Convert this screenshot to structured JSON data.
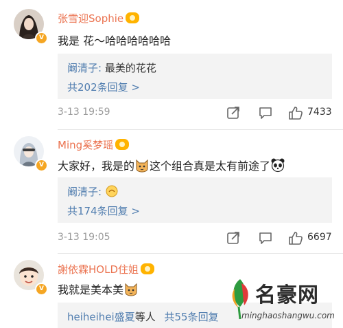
{
  "comments": [
    {
      "username": "张雪迎Sophie",
      "text": "我是 花～哈哈哈哈哈哈",
      "reply_preview_author": "阚清子:",
      "reply_preview_text": "最美的花花",
      "reply_count": "共202条回复 >",
      "time": "3-13 19:59",
      "likes": "7433"
    },
    {
      "username": "Ming奚梦瑶",
      "text_parts": [
        "大家好，我是的",
        "这个组合真是太有前途了"
      ],
      "reply_preview_author": "阚清子:",
      "reply_count": "共174条回复 >",
      "time": "3-13 19:05",
      "likes": "6697"
    },
    {
      "username": "謝依霖HOLD住姐",
      "text": "我就是美本美",
      "reply_preview_author": "heiheihei盛夏",
      "reply_preview_text": "等人",
      "reply_count": "共55条回复"
    }
  ],
  "watermark": {
    "brand": "名豪网",
    "url": "minghaoshangwu.com"
  },
  "icons": {
    "share": "share-icon",
    "comment": "comment-icon",
    "like": "thumbs-up-icon",
    "verified": "verified-badge-icon",
    "medal": "fan-medal-icon"
  },
  "colors": {
    "username": "#eb7350",
    "link": "#507daf",
    "reply_bg": "#f3f3f3",
    "meta": "#9b9b9b",
    "verified": "#f5a623"
  }
}
